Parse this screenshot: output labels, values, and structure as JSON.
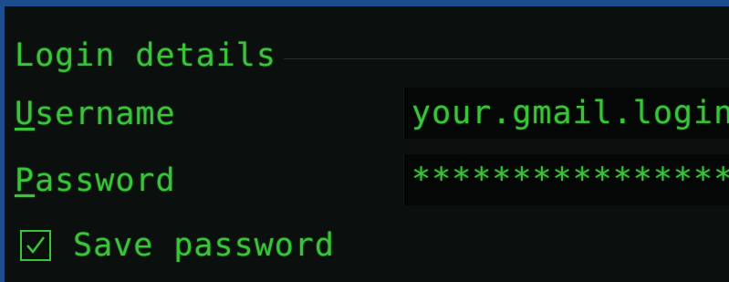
{
  "group": {
    "title": "Login details"
  },
  "username": {
    "label_mnemonic": "U",
    "label_rest": "sername",
    "placeholder": "your.gmail.login"
  },
  "password": {
    "label_mnemonic": "P",
    "label_rest": "assword",
    "masked_value": "****************"
  },
  "save_password": {
    "label": "Save password",
    "checked": true
  },
  "colors": {
    "text": "#39c439",
    "window_bg": "#0b0f0d",
    "field_bg": "#050706",
    "frame": "#1c4e8e"
  }
}
